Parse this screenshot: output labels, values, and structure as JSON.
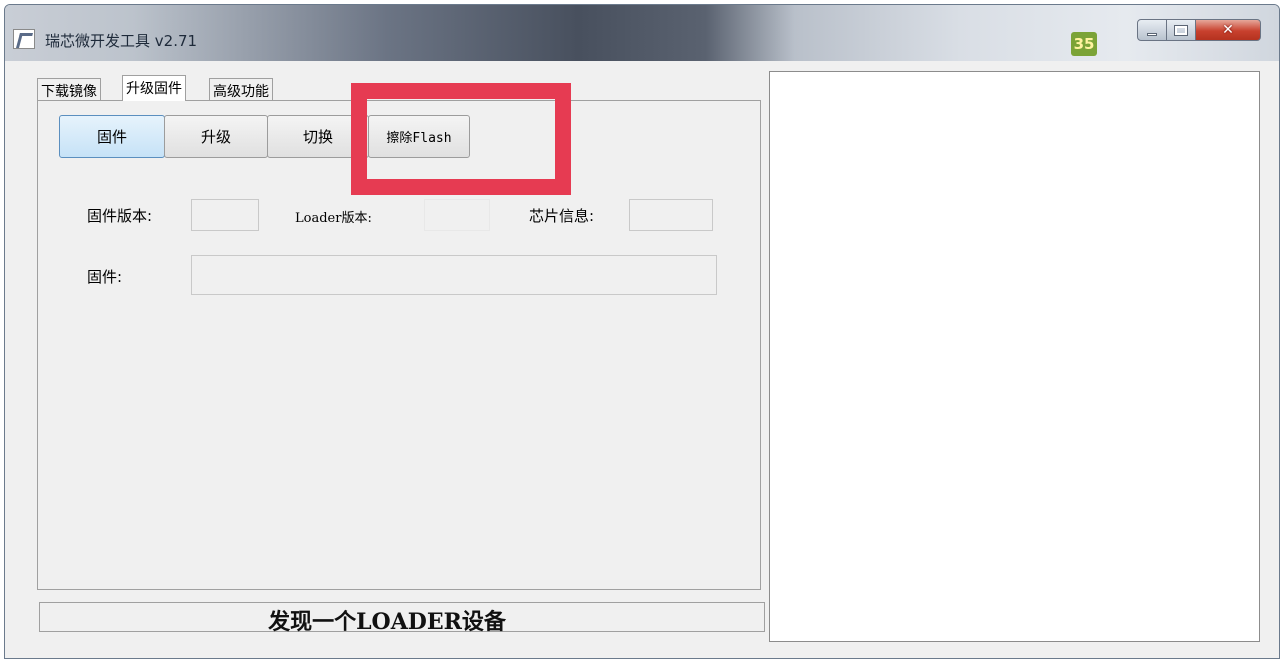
{
  "window": {
    "title": "瑞芯微开发工具 v2.71",
    "badge": "35",
    "close_glyph": "✕"
  },
  "tabs": [
    {
      "label": "下载镜像",
      "active": false
    },
    {
      "label": "升级固件",
      "active": true
    },
    {
      "label": "高级功能",
      "active": false
    }
  ],
  "toolbar": {
    "firmware_label": "固件",
    "upgrade_label": "升级",
    "switch_label": "切换",
    "erase_label": "擦除Flash"
  },
  "info": {
    "fw_version_label": "固件版本:",
    "fw_version_value": "",
    "loader_version_label": "Loader版本:",
    "loader_version_value": "",
    "chip_info_label": "芯片信息:",
    "chip_info_value": "",
    "fw_label": "固件:",
    "fw_value": ""
  },
  "status": {
    "text": "发现一个LOADER设备"
  },
  "colors": {
    "highlight": "#e63b52",
    "badge_bg": "#7ba337"
  }
}
